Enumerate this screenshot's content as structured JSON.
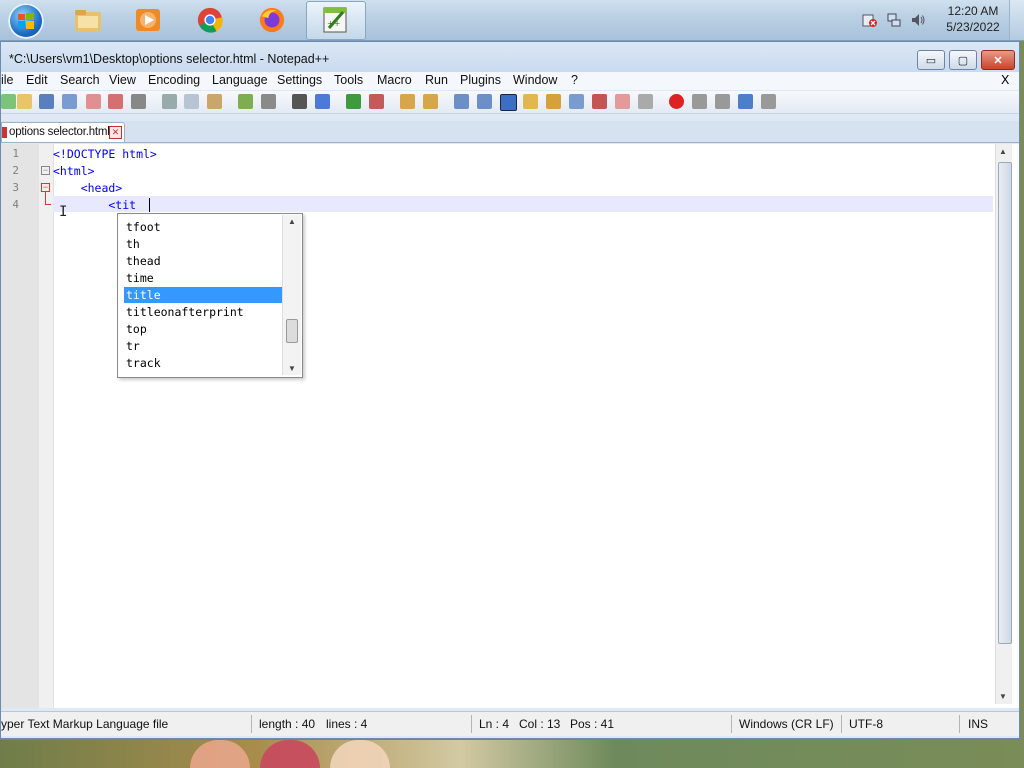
{
  "taskbar": {
    "clock_time": "12:20 AM",
    "clock_date": "5/23/2022",
    "apps": [
      "windows-start",
      "file-explorer",
      "media-player",
      "chrome",
      "firefox",
      "notepadpp"
    ]
  },
  "window": {
    "title": "*C:\\Users\\vm1\\Desktop\\options selector.html - Notepad++",
    "controls": {
      "minimize": "▭",
      "maximize": "▢",
      "close": "✕"
    }
  },
  "menu": {
    "items": [
      "ile",
      "Edit",
      "Search",
      "View",
      "Encoding",
      "Language",
      "Settings",
      "Tools",
      "Macro",
      "Run",
      "Plugins",
      "Window",
      "?"
    ],
    "close_doc": "X"
  },
  "tab": {
    "label": "options selector.html",
    "close": "✕"
  },
  "editor": {
    "line_numbers": [
      "1",
      "2",
      "3",
      "4"
    ],
    "lines": [
      "<!DOCTYPE html>",
      "<html>",
      "    <head>",
      "        <tit"
    ]
  },
  "autocomplete": {
    "items": [
      "tfoot",
      "th",
      "thead",
      "time",
      "title",
      "titleonafterprint",
      "top",
      "tr",
      "track"
    ],
    "selected_index": 4
  },
  "statusbar": {
    "filetype": "yper Text Markup Language file",
    "length": "length : 40",
    "lines": "lines : 4",
    "ln": "Ln : 4",
    "col": "Col : 13",
    "pos": "Pos : 41",
    "eol": "Windows (CR LF)",
    "encoding": "UTF-8",
    "mode": "INS"
  },
  "colors": {
    "accent_selection": "#3399ff",
    "line_highlight": "#e8e8ff",
    "tag_blue": "#0000ff"
  }
}
